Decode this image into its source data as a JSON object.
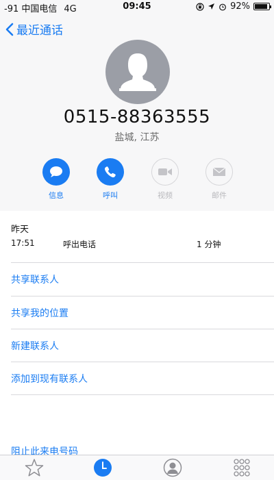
{
  "status_bar": {
    "carrier": "-91 中国电信",
    "network": "4G",
    "time": "09:45",
    "battery": "92%",
    "battery_level": 0.92
  },
  "nav": {
    "back_label": "最近通话"
  },
  "contact": {
    "number": "0515-88363555",
    "location": "盐城, 江苏"
  },
  "actions": {
    "message": "信息",
    "call": "呼叫",
    "video": "视频",
    "mail": "邮件"
  },
  "history": {
    "day": "昨天",
    "call": {
      "time": "17:51",
      "type": "呼出电话",
      "duration": "1 分钟"
    }
  },
  "menu": {
    "share_contact": "共享联系人",
    "share_location": "共享我的位置",
    "new_contact": "新建联系人",
    "add_existing": "添加到现有联系人",
    "block": "阻止此来电号码"
  },
  "colors": {
    "accent": "#1a7cf2",
    "avatar": "#9b9ea6",
    "disabled": "#b9b9bd"
  },
  "tab_icons": [
    "star-icon",
    "clock-icon",
    "person-icon",
    "keypad-icon"
  ]
}
